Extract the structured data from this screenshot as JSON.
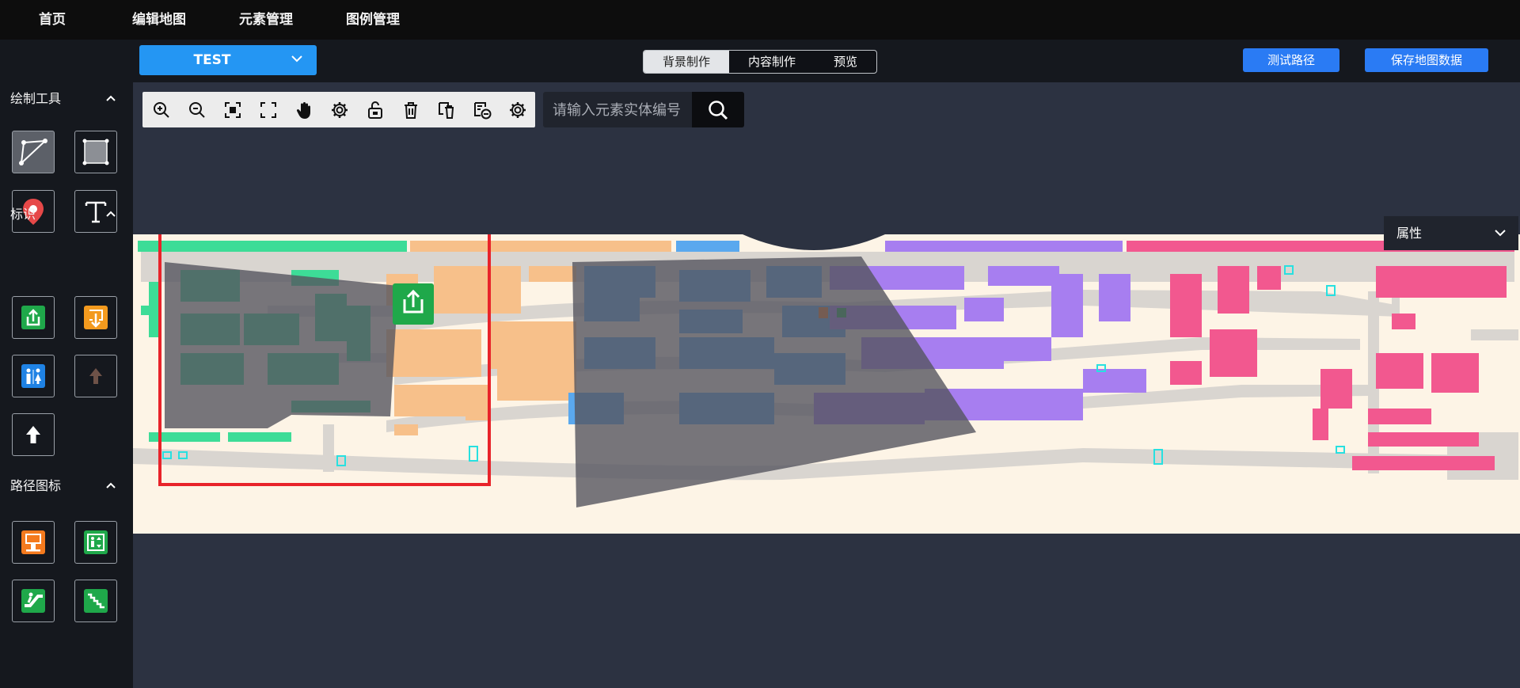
{
  "nav": {
    "items": [
      "首页",
      "编辑地图",
      "元素管理",
      "图例管理"
    ]
  },
  "map_select": {
    "value": "TEST"
  },
  "mode_tabs": [
    "背景制作",
    "内容制作",
    "预览"
  ],
  "actions": {
    "test_route": "测试路径",
    "save_map": "保存地图数据"
  },
  "sidebar": {
    "draw_tools": {
      "title": "绘制工具"
    },
    "markers": {
      "title": "标识"
    },
    "route_icons": {
      "title": "路径图标"
    }
  },
  "search": {
    "placeholder": "请输入元素实体编号"
  },
  "properties": {
    "label": "属性"
  },
  "colors": {
    "accent": "#2496f3",
    "button_blue": "#2a7bf4",
    "selection_red": "#e8232a",
    "map_bg": "#fdf4e6",
    "zone_green": "#3ddc97",
    "zone_orange": "#f7c08a",
    "zone_blue": "#5aa8ee",
    "zone_purple": "#a77ef0",
    "zone_pink": "#f2588f"
  }
}
